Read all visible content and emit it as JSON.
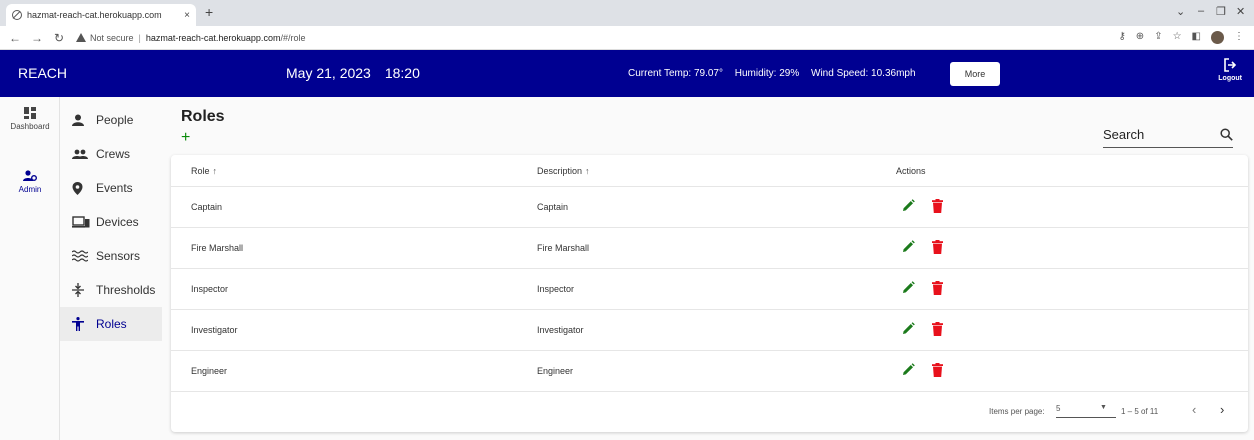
{
  "browser": {
    "tab_title": "hazmat-reach-cat.herokuapp.com",
    "tab_close": "×",
    "new_tab": "+",
    "not_secure": "Not secure",
    "url_host": "hazmat-reach-cat.herokuapp.com",
    "url_path": "/#/role"
  },
  "header": {
    "brand": "REACH",
    "date": "May 21, 2023",
    "time": "18:20",
    "temp": "Current Temp: 79.07°",
    "humidity": "Humidity: 29%",
    "wind": "Wind Speed: 10.36mph",
    "more_label": "More",
    "logout_label": "Logout"
  },
  "rail": {
    "dashboard": "Dashboard",
    "admin": "Admin"
  },
  "subnav": [
    {
      "label": "People",
      "icon": "person-icon"
    },
    {
      "label": "Crews",
      "icon": "group-icon"
    },
    {
      "label": "Events",
      "icon": "location-pin-icon"
    },
    {
      "label": "Devices",
      "icon": "devices-icon"
    },
    {
      "label": "Sensors",
      "icon": "waves-icon"
    },
    {
      "label": "Thresholds",
      "icon": "threshold-icon"
    },
    {
      "label": "Roles",
      "icon": "accessibility-icon"
    }
  ],
  "main": {
    "title": "Roles",
    "search_placeholder": "Search"
  },
  "table": {
    "headers": {
      "role": "Role",
      "description": "Description",
      "actions": "Actions"
    },
    "rows": [
      {
        "role": "Captain",
        "description": "Captain"
      },
      {
        "role": "Fire Marshall",
        "description": "Fire Marshall"
      },
      {
        "role": "Inspector",
        "description": "Inspector"
      },
      {
        "role": "Investigator",
        "description": "Investigator"
      },
      {
        "role": "Engineer",
        "description": "Engineer"
      }
    ]
  },
  "paginator": {
    "items_per_page_label": "Items per page:",
    "items_per_page_value": "5",
    "range": "1 – 5 of 11"
  },
  "colors": {
    "appbar": "#000091",
    "edit": "#1b7a1b",
    "delete": "#e8111c"
  }
}
